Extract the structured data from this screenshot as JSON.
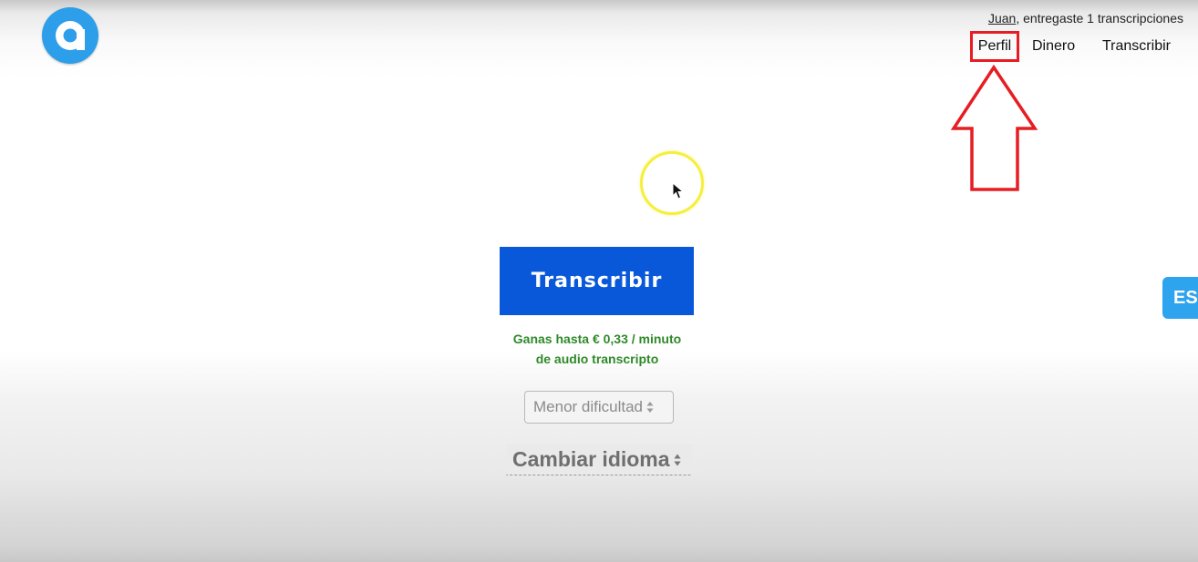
{
  "header": {
    "user_name": "Juan",
    "user_suffix": ", entregaste 1 transcripciones"
  },
  "nav": {
    "items": [
      {
        "label": "Perfil"
      },
      {
        "label": "Dinero"
      },
      {
        "label": "Transcribir"
      }
    ]
  },
  "main": {
    "cta_label": "Transcribir",
    "earn_line1": "Ganas hasta € 0,33 / minuto",
    "earn_line2": "de audio transcripto",
    "difficulty_selected": "Menor dificultad",
    "language_selected": "Cambiar idioma"
  },
  "side_tab": {
    "label": "ES"
  },
  "colors": {
    "brand_blue": "#2d9ee9",
    "cta_blue": "#0a58da",
    "earn_green": "#2f8a29",
    "highlight_red": "#e61d22",
    "cursor_yellow": "#f5ef3b"
  }
}
